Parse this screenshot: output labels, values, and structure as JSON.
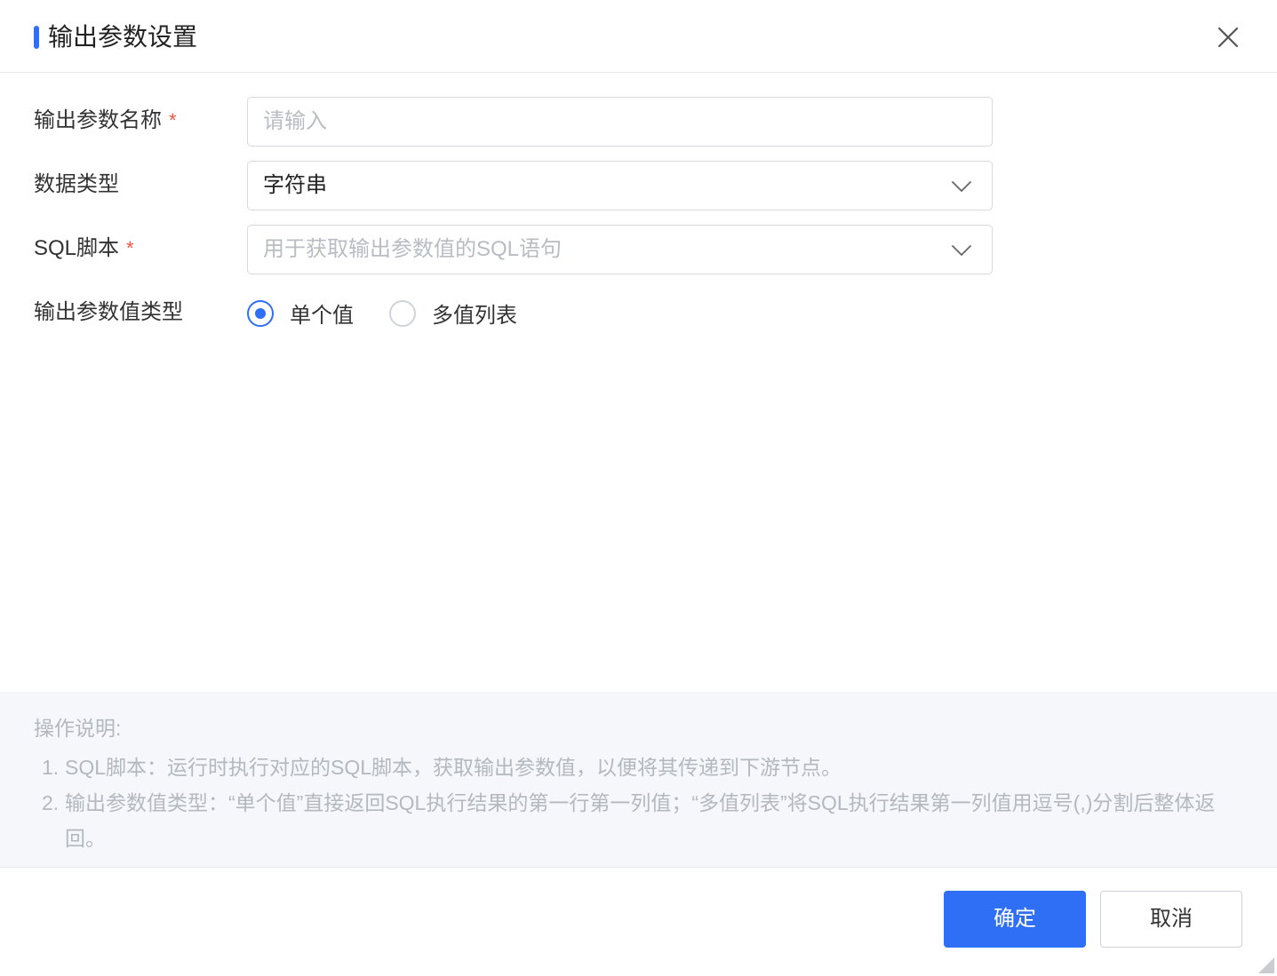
{
  "dialog": {
    "title": "输出参数设置",
    "accent_color": "#2f6ff6"
  },
  "form": {
    "name": {
      "label": "输出参数名称",
      "required_mark": "*",
      "placeholder": "请输入",
      "value": ""
    },
    "data_type": {
      "label": "数据类型",
      "selected": "字符串"
    },
    "sql_script": {
      "label": "SQL脚本",
      "required_mark": "*",
      "placeholder": "用于获取输出参数值的SQL语句"
    },
    "value_type": {
      "label": "输出参数值类型",
      "options": [
        {
          "label": "单个值",
          "checked": true
        },
        {
          "label": "多值列表",
          "checked": false
        }
      ]
    }
  },
  "notes": {
    "title": "操作说明:",
    "items": [
      {
        "num": "1.",
        "text": "SQL脚本：运行时执行对应的SQL脚本，获取输出参数值，以便将其传递到下游节点。"
      },
      {
        "num": "2.",
        "text": "输出参数值类型：“单个值”直接返回SQL执行结果的第一行第一列值；“多值列表”将SQL执行结果第一列值用逗号(,)分割后整体返回。"
      }
    ]
  },
  "footer": {
    "confirm_label": "确定",
    "cancel_label": "取消"
  },
  "icons": {
    "close": "close-icon",
    "dropdown": "chevron-down-icon",
    "resize": "resize-handle-icon"
  }
}
